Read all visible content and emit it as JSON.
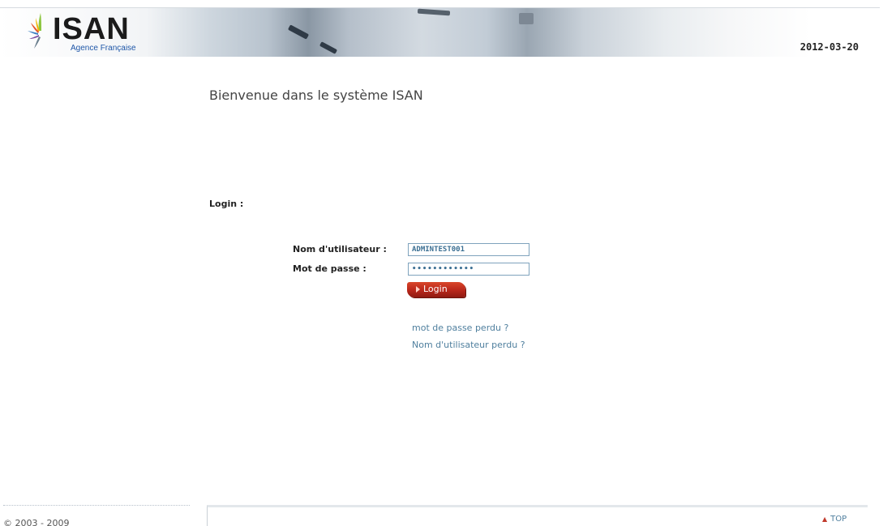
{
  "header": {
    "logo_text": "ISAN",
    "logo_subtitle": "Agence Française",
    "date": "2012-03-20"
  },
  "main": {
    "welcome": "Bienvenue dans le système ISAN",
    "login_heading": "Login :",
    "username_label": "Nom d'utilisateur :",
    "username_value": "ADMINTEST001",
    "password_label": "Mot de passe :",
    "password_value": "••••••••••••",
    "login_button_label": "Login",
    "lost_password_link": "mot de passe perdu ?",
    "lost_username_link": "Nom d'utilisateur perdu ?"
  },
  "footer": {
    "copyright": "© 2003 - 2009",
    "top_link": "TOP"
  },
  "colors": {
    "accent_red": "#b8261a",
    "link_blue": "#4f7f9e",
    "logo_blue": "#1f57a8"
  }
}
